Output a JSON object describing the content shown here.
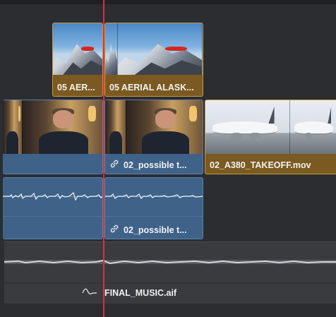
{
  "clips": {
    "v2_aerial_short": {
      "label": "05 AER..."
    },
    "v2_aerial_main": {
      "label": "05 AERIAL  ALASK..."
    },
    "v1_interview": {
      "label": ""
    },
    "v1_interview_linked": {
      "label": "02_possible t..."
    },
    "v1_takeoff": {
      "label": "02_A380_TAKEOFF.mov"
    },
    "a1_interview_linked": {
      "label": "02_possible t..."
    },
    "a2_music": {
      "label": "FINAL_MUSIC.aif"
    }
  },
  "colors": {
    "video_clip_gold": "#7b5a21",
    "video_clip_blue": "#3f6289",
    "playhead": "#d8313d",
    "track_bg": "#2b2d31",
    "music_track_bg": "#3a3b3e"
  },
  "icons": {
    "link": "link-icon",
    "volume_curve": "volume-curve-icon"
  }
}
